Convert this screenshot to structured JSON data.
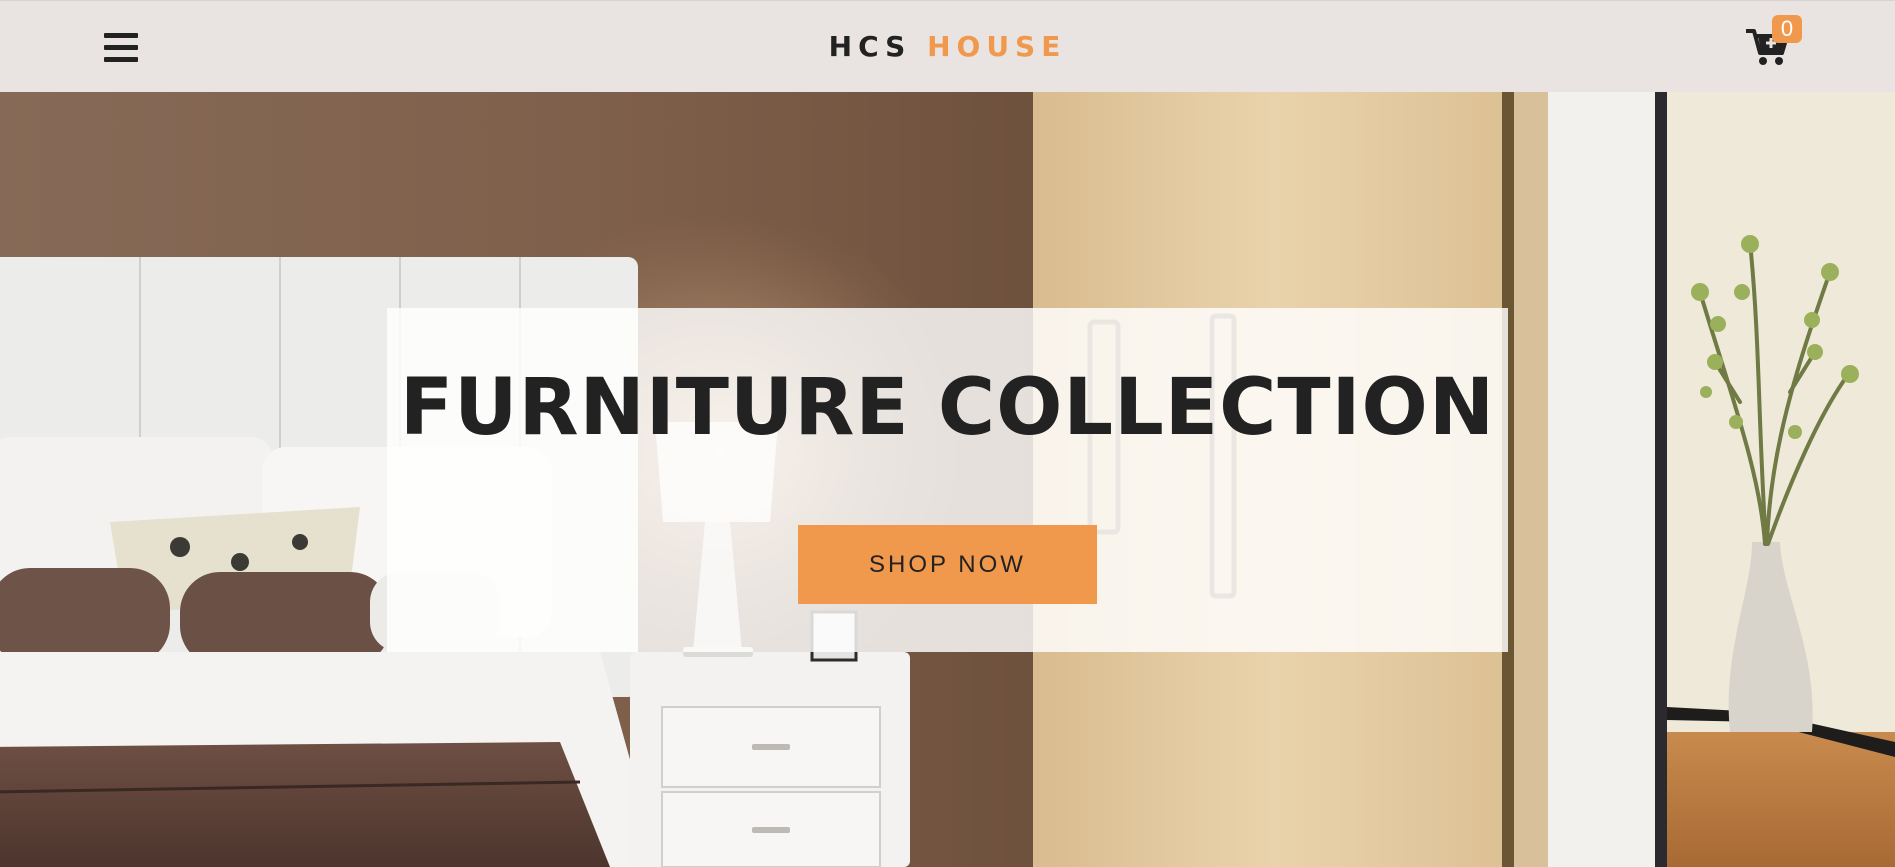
{
  "header": {
    "menu_icon": "hamburger-menu-icon",
    "brand_primary": "HCS",
    "brand_accent": "HOUSE",
    "cart_icon": "cart-plus-icon",
    "cart_count": "0"
  },
  "hero": {
    "title": "FURNITURE COLLECTION",
    "cta_label": "SHOP NOW",
    "background_image": "bedroom-interior-photo"
  },
  "colors": {
    "accent": "#f0994d",
    "navbar_bg": "#e9e4e1",
    "text_dark": "#222222"
  }
}
